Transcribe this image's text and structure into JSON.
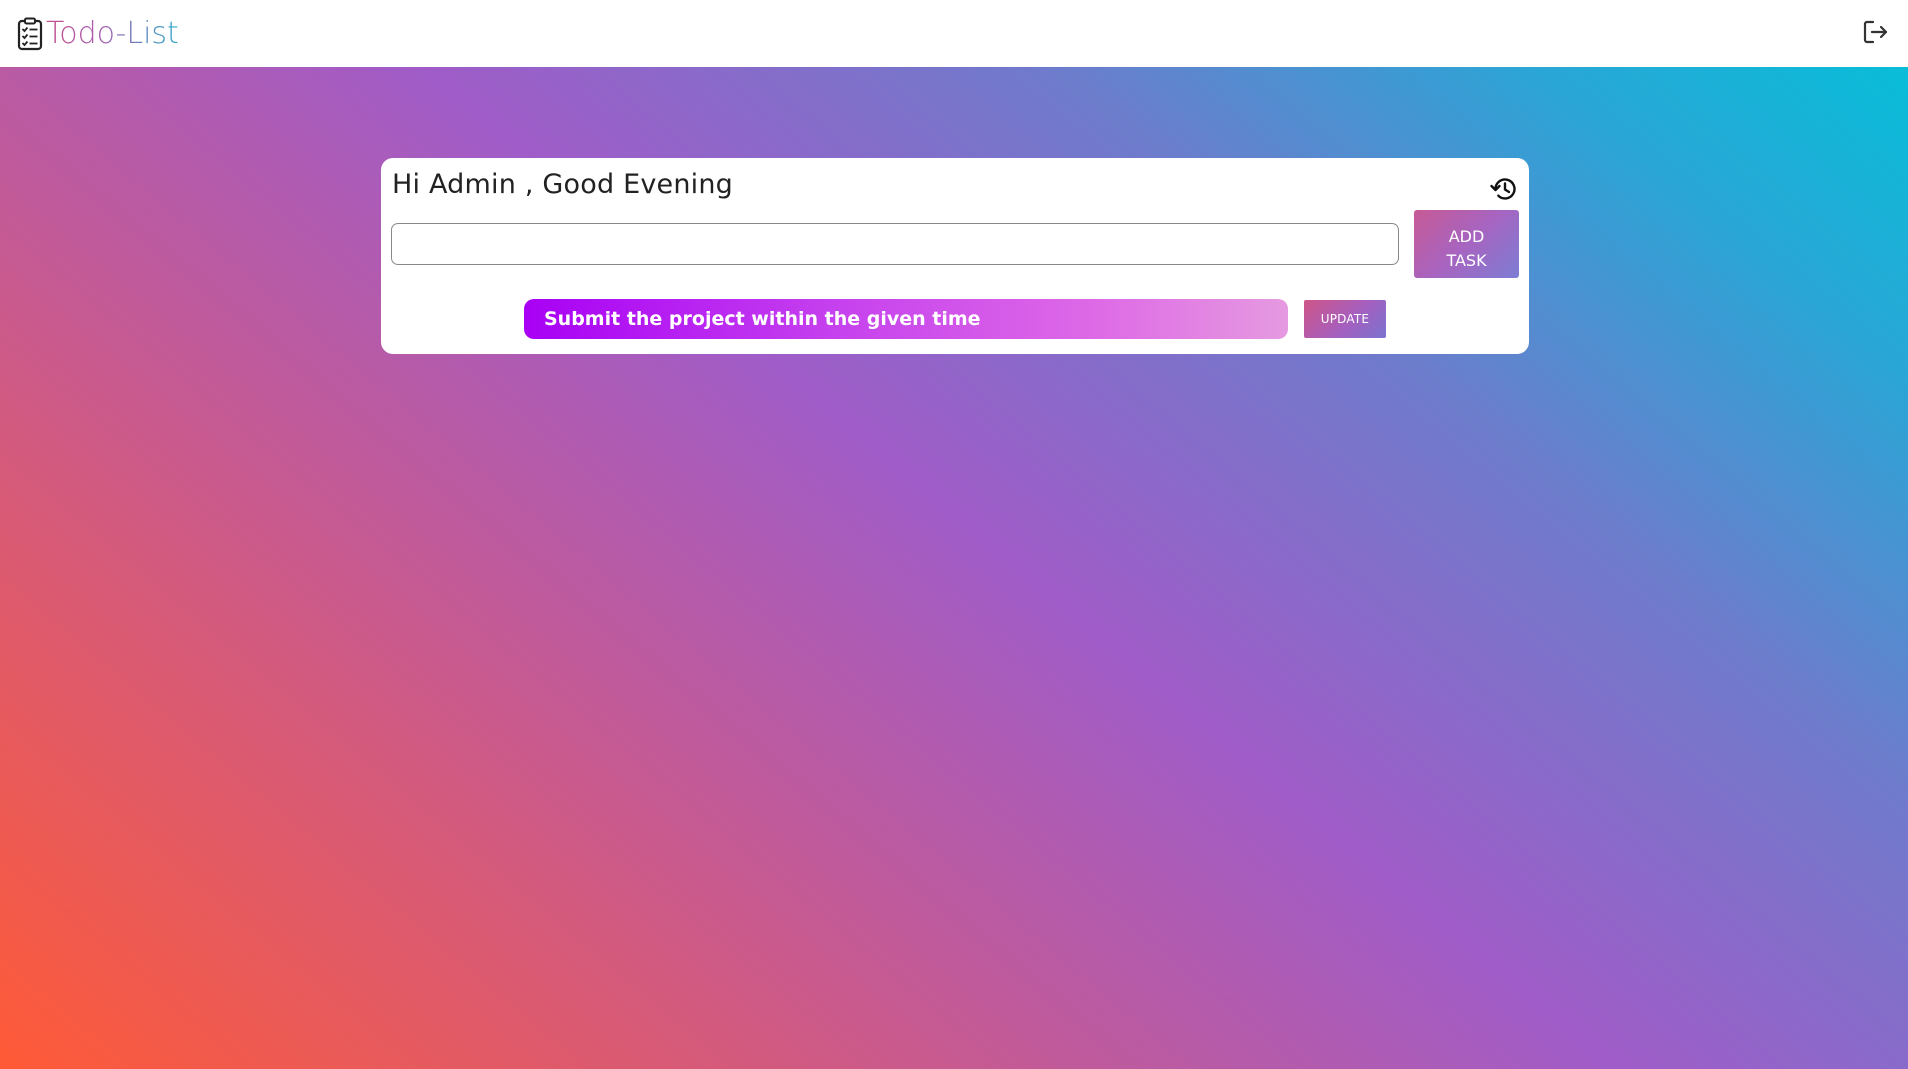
{
  "app": {
    "title": "Todo-List",
    "brand_icon": "clipboard-checklist-icon",
    "logout_icon": "logout-icon"
  },
  "card": {
    "greeting": "Hi Admin , Good Evening",
    "history_icon": "history-icon",
    "task_input": {
      "value": "",
      "placeholder": ""
    },
    "add_button_label": "ADD\nTASK"
  },
  "tasks": [
    {
      "text": "Submit the project within the given time",
      "action_label": "UPDATE"
    }
  ],
  "colors": {
    "brand_gradient_start": "#c44f8f",
    "brand_gradient_end": "#2aa9c7",
    "background_gradient": [
      "#ff5a36",
      "#c95a8e",
      "#a05cc8",
      "#6f7bcc",
      "#08bdd8"
    ],
    "task_gradient": [
      "#a800f5",
      "#e59ae0"
    ]
  }
}
